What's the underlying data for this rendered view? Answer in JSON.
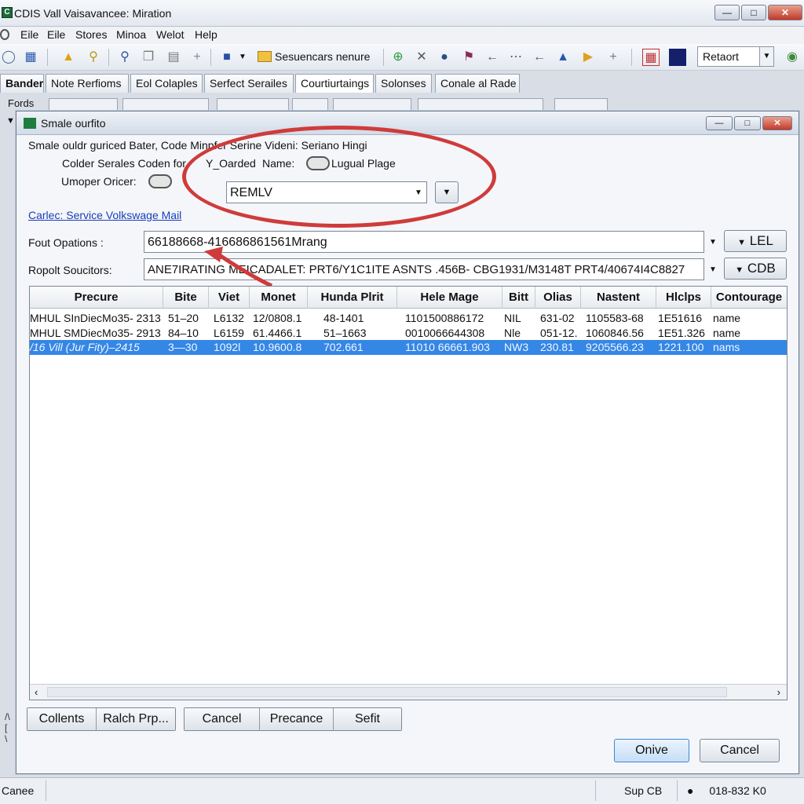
{
  "window": {
    "title": "CDIS Vall Vaisavancee: Miration"
  },
  "menu": [
    "Eile",
    "Eile",
    "Stores",
    "Minoa",
    "Welot",
    "Help"
  ],
  "toolbar": {
    "folder_label": "Sesuencars nenure",
    "combo_value": "Retaort"
  },
  "tabs": [
    "Bander",
    "Note Rerfioms",
    "Eol Colaples",
    "Serfect Serailes",
    "Courtiurtaings",
    "Solonses",
    "Conale al Rade"
  ],
  "subtabs_label": "Fords",
  "dialog": {
    "title": "Smale ourfito",
    "line1": "Smale ouldr guriced Bater, Code Minpfer Serine Videni: Seriano Hingi",
    "coder_label": "Colder Serales Coden for",
    "oarded": "Y_Oarded",
    "name_label": "Name:",
    "lugual": "Lugual Plage",
    "umoper_label": "Umoper Oricer:",
    "remlv": "REMLV",
    "link": "Carlec: Service Volkswage Mail",
    "fout_label": "Fout Opations :",
    "fout_value": "66188668-416686861561Mrang",
    "lel_btn": "LEL",
    "ropolt_label": "Ropolt Soucitors:",
    "ropolt_value": "ANE7IRATING MEICADALET: PRT6/Y1C1ITE  ASNTS .456B- CBG1931/M3148T  PRT4/40674I4C8827",
    "cdb_btn": "CDB"
  },
  "table": {
    "columns": [
      "Precure",
      "Bite",
      "Viet",
      "Monet",
      "Hunda Plrit",
      "Hele Mage",
      "Bitt",
      "Olias",
      "Nastent",
      "Hlclps",
      "Contourage"
    ],
    "rows": [
      [
        "MHUL SInDiecMo35- 2313",
        "51–20",
        "L6132",
        "12/0808.1",
        "48-1401",
        "1101500886172",
        "NIL",
        "631-02",
        "1105583-68",
        "1E51616",
        "name"
      ],
      [
        "MHUL SMDiecMo35- 2913",
        "84–10",
        "L6159",
        "61.4466.1",
        "51–1663",
        "0010066644308",
        "Nle",
        "051-12.",
        "1060846.56",
        "1E51.326",
        "name"
      ],
      [
        "/16 Vill (Jur Fity)–2415",
        "3—30",
        "1092l",
        "10.9600.8",
        "702.661",
        "11010 66661.903",
        "NW3",
        "230.81",
        "9205566.23",
        "1221.100",
        "nams"
      ]
    ],
    "selected_row": 2
  },
  "buttons": {
    "collents": "Collents",
    "ralch": "Ralch Prp...",
    "cancel": "Cancel",
    "precance": "Precance",
    "sefit": "Sefit",
    "onive": "Onive",
    "cancel2": "Cancel"
  },
  "status": {
    "left": "Canee",
    "sup": "Sup CB",
    "code": "018-832 K0"
  },
  "colors": {
    "accent": "#3587e6",
    "annotation": "#cf3b3b",
    "link": "#1a3dbb"
  }
}
